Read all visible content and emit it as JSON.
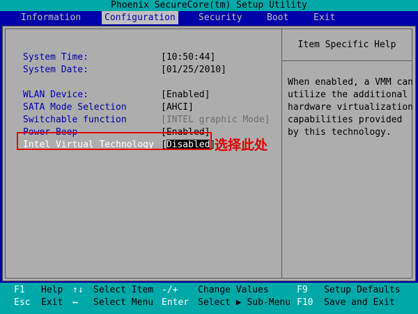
{
  "title": "Phoenix SecureCore(tm) Setup Utility",
  "menu": [
    {
      "label": "Information",
      "active": false
    },
    {
      "label": "Configuration",
      "active": true
    },
    {
      "label": "Security",
      "active": false
    },
    {
      "label": "Boot",
      "active": false
    },
    {
      "label": "Exit",
      "active": false
    }
  ],
  "settings": [
    {
      "label": "System Time:",
      "value": "[10:50:44]"
    },
    {
      "label": "System Date:",
      "value": "[01/25/2010]"
    },
    {
      "label": "WLAN Device:",
      "value": "[Enabled]"
    },
    {
      "label": "SATA Mode Selection",
      "value": "[AHCI]"
    },
    {
      "label": "Switchable function",
      "value": "[INTEL graphic Mode]"
    },
    {
      "label": "Power Beep",
      "value": "[Enabled]"
    },
    {
      "label": "Intel Virtual Technology",
      "value": "Disabled",
      "bracket_open": "[",
      "bracket_close": "]"
    }
  ],
  "help": {
    "title": "Item Specific Help",
    "text": "When enabled, a VMM can\nutilize the additional\nhardware virtualization\ncapabilities provided\nby this technology."
  },
  "annotation": "选择此处",
  "status": {
    "row1": [
      {
        "key": "F1",
        "desc": "Help"
      },
      {
        "key": "↑↓",
        "desc": "Select Item"
      },
      {
        "key": "-/+",
        "desc": "Change Values"
      },
      {
        "key": "F9",
        "desc": "Setup Defaults"
      }
    ],
    "row2": [
      {
        "key": "Esc",
        "desc": "Exit"
      },
      {
        "key": "↔",
        "desc": "Select Menu"
      },
      {
        "key": "Enter",
        "desc": "Select ▶ Sub-Menu"
      },
      {
        "key": "F10",
        "desc": "Save and Exit"
      }
    ]
  },
  "colors": {
    "background": "#0000a8",
    "panel": "#adadad",
    "bars": "#00a8a8",
    "annotation": "#e00000"
  }
}
